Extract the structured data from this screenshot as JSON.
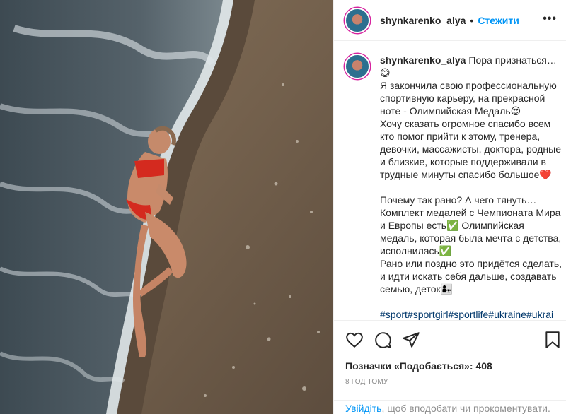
{
  "post": {
    "username": "shynkarenko_alya",
    "follow_label": "Стежити",
    "separator": "•",
    "more_label": "•••"
  },
  "caption": {
    "username": "shynkarenko_alya",
    "text": "Пора признаться…😅\nЯ закончила свою профессиональную спортивную карьеру, на прекрасной ноте - Олимпийская Медаль😍\nХочу сказать огромное спасибо всем кто помог прийти к этому, тренера, девочки, массажисты, доктора, родные и близкие, которые поддерживали в трудные минуты спасибо большое❤️\n\nПочему так рано? А чего тянуть… Комплект медалей с Чемпионата Мира и Европы есть✅ Олимпийская медаль, которая была мечта с детства, исполнилась✅\nРано или поздно это придётся сделать, и идти искать себя дальше, создавать семью, деток👩‍👧\n\n",
    "hashtags": "#sport#sportgirl#sportlife#ukraine#ukrai"
  },
  "actions": {
    "like_icon": "heart-icon",
    "comment_icon": "comment-icon",
    "share_icon": "share-icon",
    "save_icon": "bookmark-icon"
  },
  "likes_text": "Позначки «Подобається»: 408",
  "timestamp": "8 ГОД ТОМУ",
  "login_prompt": {
    "link": "Увійдіть",
    "rest": ", щоб вподобати чи прокоментувати."
  },
  "colors": {
    "link_blue": "#0095f6",
    "hashtag": "#00376b",
    "muted": "#8e8e8e",
    "swimsuit_red": "#d42a1f"
  }
}
